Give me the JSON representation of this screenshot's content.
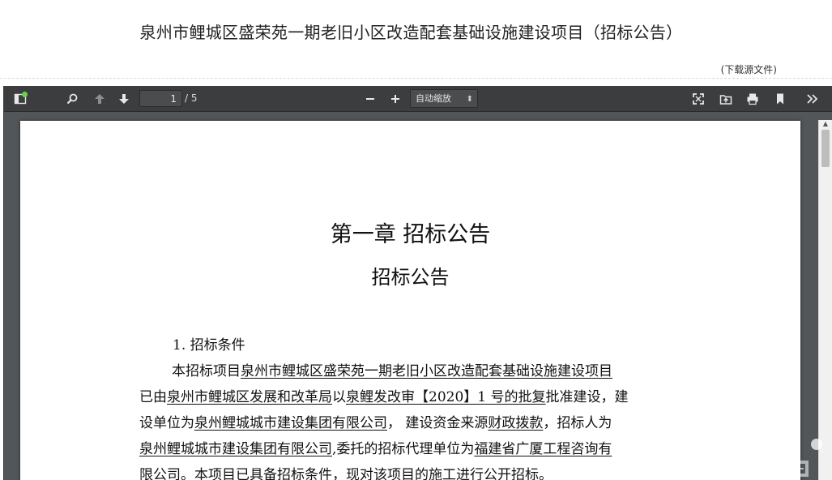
{
  "header": {
    "title": "泉州市鲤城区盛荣苑一期老旧小区改造配套基础设施建设项目（招标公告）",
    "download_label": "(下载源文件)"
  },
  "viewer": {
    "toolbar": {
      "page_value": "1",
      "page_count": "/ 5",
      "zoom_value": "自动缩放",
      "icons": [
        "sidebar-toggle-icon",
        "search-icon",
        "previous-page-icon",
        "next-page-icon",
        "zoom-out-icon",
        "zoom-in-icon",
        "presentation-mode-icon",
        "open-file-icon",
        "print-icon",
        "bookmark-icon",
        "tools-icon"
      ]
    },
    "document": {
      "chapter_title": "第一章  招标公告",
      "section_title": "招标公告",
      "clause_heading": "1. 招标条件",
      "lines": [
        [
          {
            "t": "本招标项目",
            "u": false
          },
          {
            "t": "泉州市鲤城区盛荣苑一期老旧小区改造配套基础设施建设项目",
            "u": true
          }
        ],
        [
          {
            "t": "已由",
            "u": false
          },
          {
            "t": "泉州市鲤城区发展和改革局",
            "u": true
          },
          {
            "t": "以",
            "u": false
          },
          {
            "t": "泉鲤发改审【2020】1 号的批复",
            "u": true
          },
          {
            "t": "批准建设，建",
            "u": false
          }
        ],
        [
          {
            "t": "设单位为",
            "u": false
          },
          {
            "t": "泉州鲤城城市建设集团有限公司",
            "u": true
          },
          {
            "t": "，  建设资金来源",
            "u": false
          },
          {
            "t": "财政拨款",
            "u": true
          },
          {
            "t": "，招标人为",
            "u": false
          }
        ],
        [
          {
            "t": "泉州鲤城城市建设集团有限公司",
            "u": true
          },
          {
            "t": ",委托的招标代理单位为",
            "u": false
          },
          {
            "t": "福建省广厦工程咨询有",
            "u": true
          }
        ],
        [
          {
            "t": "限公司",
            "u": true
          },
          {
            "t": "。本项目已具备招标条件，现对该项目的施工进行公开招标。",
            "u": false
          }
        ]
      ]
    }
  },
  "colors": {
    "toolbar_bg": "#3b3d3f",
    "viewer_bg": "#525659",
    "status_dot": "#6bd14b"
  }
}
